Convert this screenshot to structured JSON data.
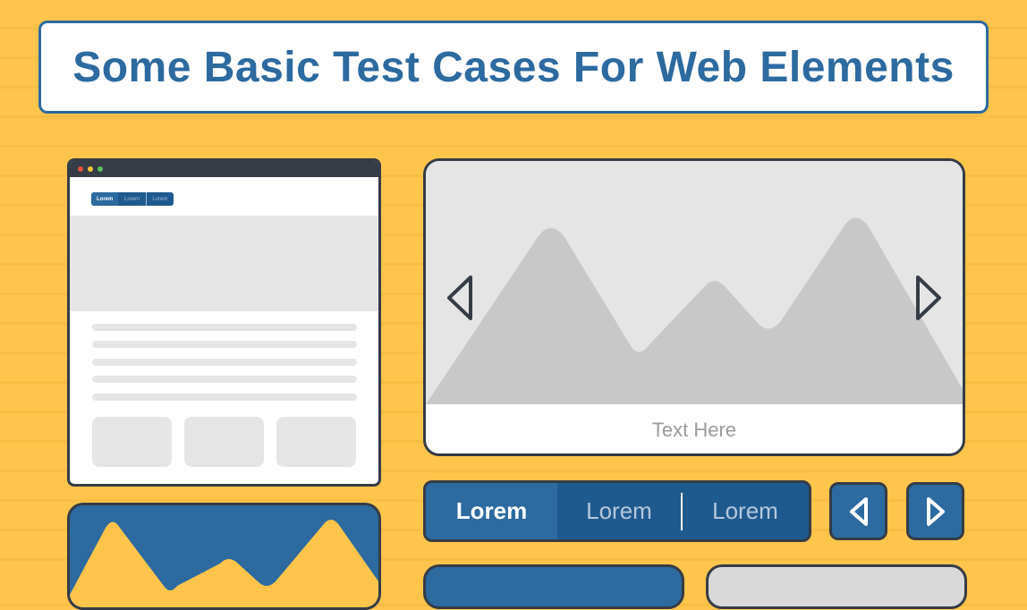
{
  "title": "Some Basic Test Cases For Web Elements",
  "browser_mock": {
    "tabs": [
      "Lorem",
      "Lorem",
      "Lorem"
    ],
    "active_tab_index": 0
  },
  "carousel": {
    "caption": "Text Here",
    "prev_icon": "chevron-left-icon",
    "next_icon": "chevron-right-icon"
  },
  "tabbar": {
    "tabs": [
      "Lorem",
      "Lorem",
      "Lorem"
    ],
    "active_tab_index": 0
  },
  "nav_buttons": {
    "prev_icon": "chevron-left-icon",
    "next_icon": "chevron-right-icon"
  },
  "colors": {
    "background": "#ffc44c",
    "primary_blue": "#2c6aa0",
    "dark_blue": "#1f5a8f",
    "outline": "#353c46",
    "placeholder_gray": "#e5e5e6",
    "mountain_gray": "#c8c8c8"
  }
}
